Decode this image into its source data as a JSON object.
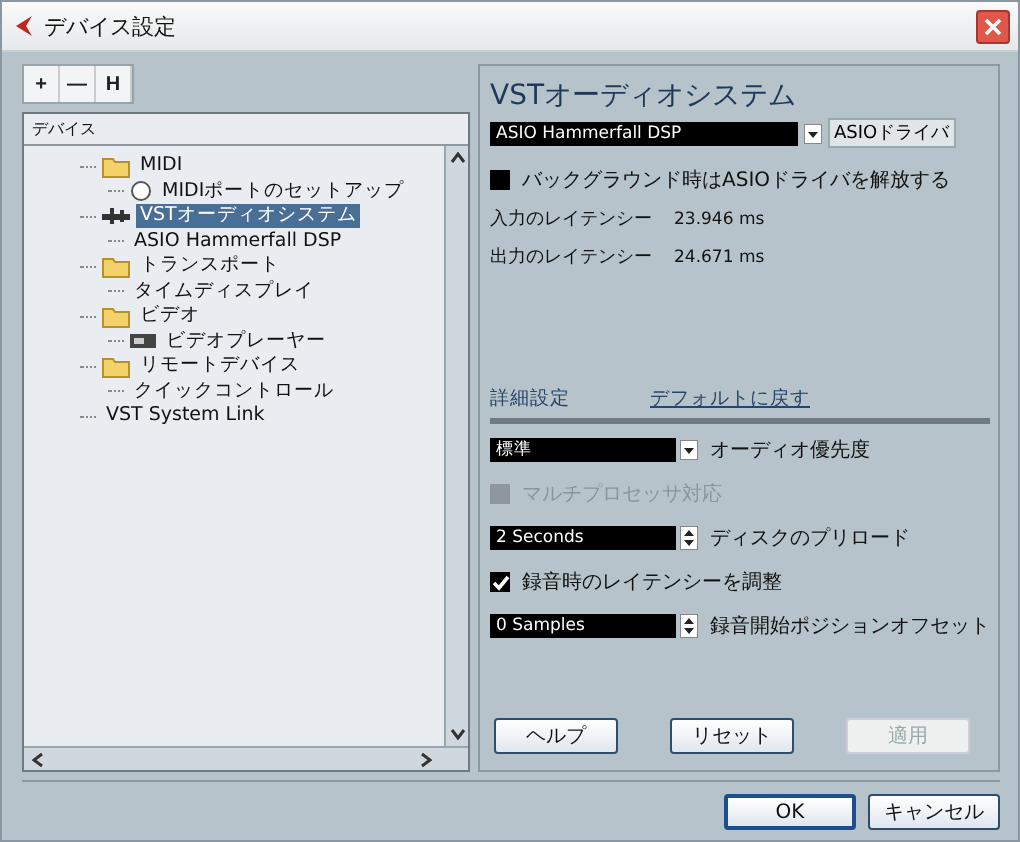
{
  "window": {
    "title": "デバイス設定"
  },
  "toolbar": [
    "+",
    "—",
    "H"
  ],
  "tree": {
    "header": "デバイス",
    "items": [
      {
        "label": "MIDI",
        "kind": "folder",
        "selected": false,
        "children": [
          {
            "label": "MIDIポートのセットアップ",
            "kind": "port",
            "selected": false
          }
        ]
      },
      {
        "label": "VSTオーディオシステム",
        "kind": "audio",
        "selected": true,
        "children": [
          {
            "label": "ASIO Hammerfall DSP",
            "kind": "none",
            "selected": false
          }
        ]
      },
      {
        "label": "トランスポート",
        "kind": "folder",
        "selected": false,
        "children": [
          {
            "label": "タイムディスプレイ",
            "kind": "none",
            "selected": false
          }
        ]
      },
      {
        "label": "ビデオ",
        "kind": "folder",
        "selected": false,
        "children": [
          {
            "label": "ビデオプレーヤー",
            "kind": "player",
            "selected": false
          }
        ]
      },
      {
        "label": "リモートデバイス",
        "kind": "folder",
        "selected": false,
        "children": [
          {
            "label": "クイックコントロール",
            "kind": "none",
            "selected": false
          }
        ]
      },
      {
        "label": "VST System Link",
        "kind": "none",
        "selected": false
      }
    ]
  },
  "panel": {
    "title": "VSTオーディオシステム",
    "driver": {
      "value": "ASIO Hammerfall DSP",
      "button": "ASIOドライバ"
    },
    "release_option": {
      "label": "バックグラウンド時はASIOドライバを解放する",
      "checked": false,
      "disabled": false
    },
    "latency": [
      {
        "label": "入力のレイテンシー",
        "value": "23.946 ms"
      },
      {
        "label": "出力のレイテンシー",
        "value": "24.671 ms"
      }
    ],
    "tabs": [
      {
        "label": "詳細設定",
        "kind": "tab"
      },
      {
        "label": "デフォルトに戻す",
        "kind": "link"
      }
    ],
    "settings": [
      {
        "kind": "dropdown",
        "current": "標準",
        "label": "オーディオ優先度"
      },
      {
        "kind": "checkbox",
        "label": "マルチプロセッサ対応",
        "checked": false,
        "disabled": true
      },
      {
        "kind": "spinner",
        "current": "2 Seconds",
        "label": "ディスクのプリロード"
      },
      {
        "kind": "checkbox",
        "label": "録音時のレイテンシーを調整",
        "checked": true,
        "disabled": false
      },
      {
        "kind": "spinner",
        "current": "0 Samples",
        "label": "録音開始ポジションオフセット"
      }
    ],
    "buttons": [
      {
        "label": "ヘルプ",
        "disabled": false
      },
      {
        "label": "リセット",
        "disabled": false
      },
      {
        "label": "適用",
        "disabled": true
      }
    ]
  },
  "footer": [
    "OK",
    "キャンセル"
  ]
}
